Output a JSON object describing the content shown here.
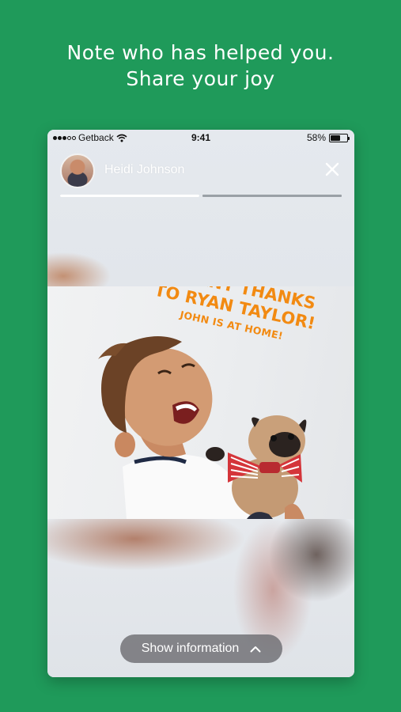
{
  "headline": {
    "line1": "Note who has helped you.",
    "line2": "Share your joy"
  },
  "status_bar": {
    "carrier": "Getback",
    "time": "9:41",
    "battery": "58%",
    "battery_level": 0.58,
    "signal_bars_filled": 3,
    "signal_bars_total": 5
  },
  "story": {
    "author": "Heidi Johnson",
    "segments": [
      {
        "progress": 1.0
      },
      {
        "progress": 0.0
      }
    ],
    "caption": {
      "line1": "MANY THANKS",
      "line2": "TO RYAN TAYLOR!",
      "line3": "JOHN IS AT HOME!"
    },
    "caption_color": "#f28a12"
  },
  "info_button": {
    "label": "Show information"
  },
  "colors": {
    "background": "#1f9a5a",
    "button": "#6e6e73"
  },
  "icons": [
    "signal-dots-icon",
    "wifi-icon",
    "battery-icon",
    "close-icon",
    "chevron-up-icon"
  ]
}
